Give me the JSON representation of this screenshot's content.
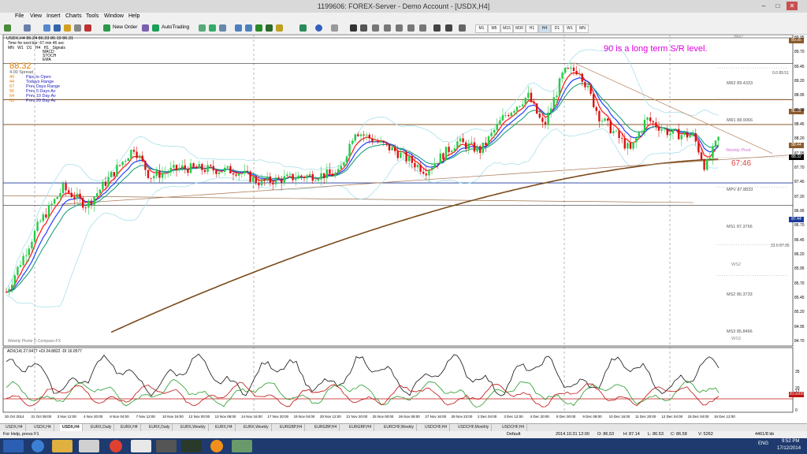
{
  "window": {
    "title": "1199606: FOREX-Server - Demo Account - [USDX,H4]"
  },
  "menu": [
    "File",
    "View",
    "Insert",
    "Charts",
    "Tools",
    "Window",
    "Help"
  ],
  "toolbar": {
    "new_order": "New Order",
    "autotrading": "AutoTrading",
    "timeframes": [
      "M1",
      "M5",
      "M15",
      "M30",
      "H1",
      "H4",
      "D1",
      "W1",
      "MN"
    ]
  },
  "chart": {
    "symbol_line": "USDX,H4  86.24 86.33 86.19 86.31",
    "timer_label": "Time for next bar: 67 min 46 sec",
    "tf_labels": [
      "MN",
      "W1",
      "D1",
      "H4",
      "H1",
      "Signals"
    ],
    "signal_labels": [
      "MACD",
      "STOCH",
      "EMA"
    ],
    "price_big": "88.32",
    "spread": "4.00 Spread",
    "stats": [
      {
        "val": "49",
        "label": "Pips to Open"
      },
      {
        "val": "44",
        "label": "Todays Range"
      },
      {
        "val": "67",
        "label": "Prev Days Range"
      },
      {
        "val": "56",
        "label": "Prev 5 Days Av"
      },
      {
        "val": "64",
        "label": "Prev 10 Day Av"
      },
      {
        "val": "55",
        "label": "Prev 20 Day Av"
      }
    ],
    "annotation": "90 is a long term S/R level.",
    "countdown": "67:46",
    "pivot_labels": {
      "wr2": "WR2",
      "fib100": "0.0  89.51",
      "mr2": "MR2  89.4333",
      "mr1": "MR1  88.9066",
      "weekly_pivot": "Weekly Pivot",
      "mpv": "MPV  87.8833",
      "ms1": "MS1  87.3766",
      "fib23": "23.6  87.05",
      "ws2": "WS2",
      "ms2": "MS2  86.3733",
      "ms3": "MS3  85.8466",
      "ws3": "WS3"
    },
    "footer_note": "Weekly Pivots  © Compass-FX",
    "adx_label": "ADX(14) 27.0477  +DI 24.8822  -DI 16.0577",
    "price_axis": [
      "89.95",
      "89.70",
      "89.45",
      "89.20",
      "88.95",
      "88.70",
      "88.45",
      "88.20",
      "87.95",
      "87.70",
      "87.45",
      "87.20",
      "86.95",
      "86.70",
      "86.45",
      "86.20",
      "85.95",
      "85.70",
      "85.45",
      "85.20",
      "84.95",
      "84.70"
    ],
    "indicator_axis": [
      "35",
      "20",
      "17",
      "0"
    ],
    "time_axis": [
      "30 Oct 2014",
      "31 Oct 08:00",
      "3 Nov 12:00",
      "4 Nov 20:00",
      "6 Nov 04:00",
      "7 Nov 12:00",
      "10 Nov 16:00",
      "12 Nov 00:00",
      "13 Nov 08:00",
      "14 Nov 16:00",
      "17 Nov 20:00",
      "19 Nov 04:00",
      "20 Nov 12:00",
      "21 Nov 20:00",
      "25 Nov 00:00",
      "26 Nov 08:00",
      "27 Nov 16:00",
      "28 Nov 22:00",
      "2 Dec 04:00",
      "3 Dec 12:00",
      "4 Dec 20:00",
      "8 Dec 00:00",
      "9 Dec 08:00",
      "10 Dec 16:00",
      "11 Dec 20:00",
      "12 Dec 04:00",
      "15 Dec 04:00",
      "16 Dec 12:00"
    ],
    "price_tags": {
      "t1": "89.95",
      "t2": "88.82",
      "t3": "88.44",
      "t4": "88.32",
      "t5": "87.44",
      "ind": "20.0000"
    }
  },
  "tabs": [
    "USDX,H4",
    "USDX,H4",
    "USDX,H4",
    "EURX,Daily",
    "EURX,H4",
    "EURX,Daily",
    "EURX,Weekly",
    "EURX,H4",
    "EURX,Weekly",
    "EURGBP,H4",
    "EURGBP,H4",
    "EURGBP,H4",
    "EURCHF,Weekly",
    "USDCHF,H4",
    "USDCHF,Monthly",
    "USDCHF,H4"
  ],
  "status": {
    "help": "For Help, press F1",
    "profile": "Default",
    "datetime": "2014.10.31 12:00",
    "o": "O: 86.53",
    "h": "H: 87.14",
    "l": "L: 86.53",
    "c": "C: 86.58",
    "v": "V: 5262",
    "traffic": "4461/8 kb"
  },
  "taskbar": {
    "lang": "ENG",
    "time": "9:52 PM",
    "date": "17/12/2014"
  },
  "colors": {
    "bull": "#22cc44",
    "bear": "#dd1111",
    "ema_red": "#ff2020",
    "ema_blue": "#2040ff",
    "ema_teal": "#20a080",
    "ma_brown": "#7a4a1a",
    "bands": "#a8e0ec",
    "hline_brown": "#8b5a2b",
    "magenta": "#e000e0"
  }
}
